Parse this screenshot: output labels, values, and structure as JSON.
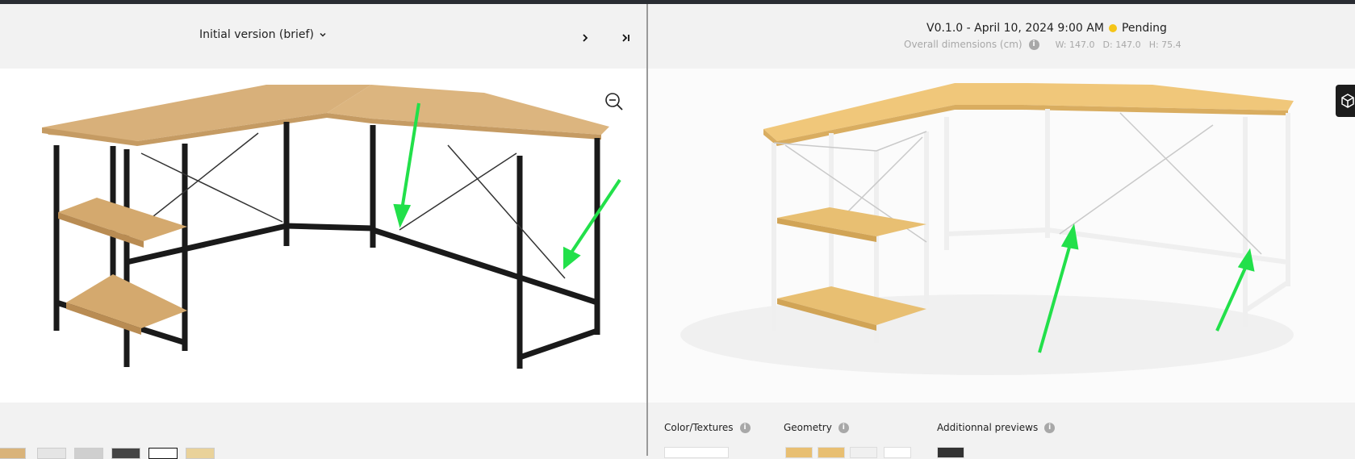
{
  "left_header": {
    "version_label": "Initial version (brief)"
  },
  "right_header": {
    "version_line": "V0.1.0 - April 10, 2024 9:00 AM",
    "status": "Pending",
    "status_color": "#f5c518",
    "dims_label": "Overall dimensions (cm)",
    "dim_w": "W: 147.0",
    "dim_d": "D: 147.0",
    "dim_h": "H: 75.4"
  },
  "bottom": {
    "color_textures_label": "Color/Textures",
    "geometry_label": "Geometry",
    "additional_previews_label": "Additionnal previews"
  },
  "colors": {
    "arrow": "#22e04a",
    "wood_light": "#d9b37a",
    "wood_oak": "#e8c98a",
    "frame_black": "#1a1a1a",
    "frame_white": "#f0f0f0"
  }
}
